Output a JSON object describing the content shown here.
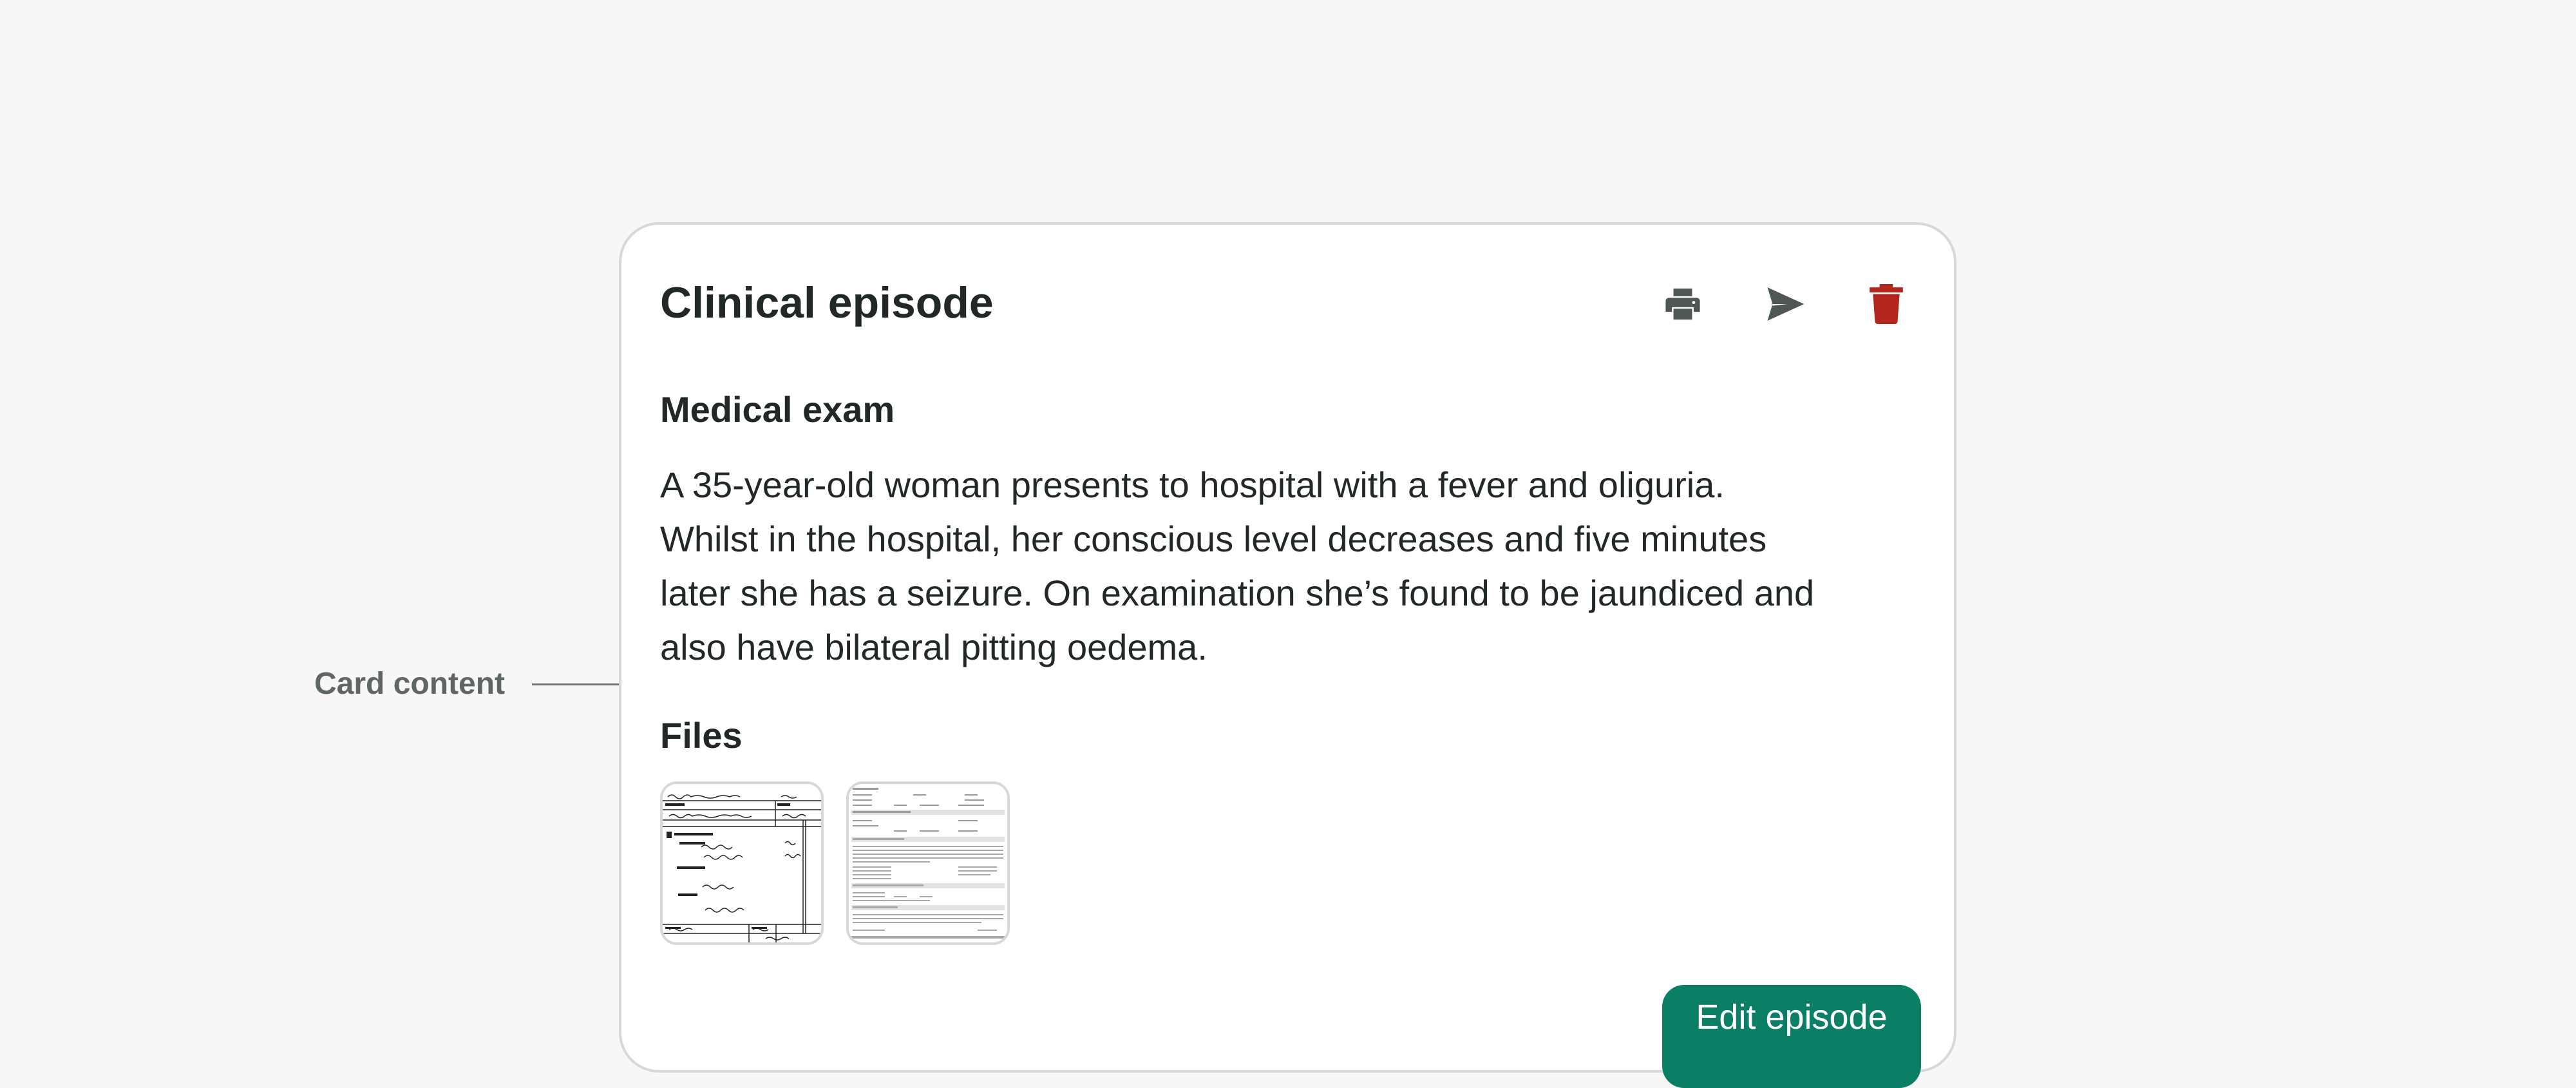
{
  "annotation": {
    "label": "Card content"
  },
  "card": {
    "title": "Clinical episode",
    "actions": {
      "print": {
        "icon": "printer-icon"
      },
      "send": {
        "icon": "send-icon"
      },
      "delete": {
        "icon": "trash-icon",
        "color": "#b3261e"
      }
    },
    "medical_exam": {
      "heading": "Medical exam",
      "lines": [
        "A 35-year-old woman presents to hospital with a fever and oliguria.",
        "Whilst in the hospital, her conscious level decreases and five minutes",
        "later she has a seizure. On examination she’s found to be jaundiced and",
        "also have bilateral pitting oedema."
      ]
    },
    "files": {
      "heading": "Files",
      "items": [
        {
          "type": "handwritten-form-thumbnail"
        },
        {
          "type": "printed-form-thumbnail"
        }
      ]
    },
    "edit_button": "Edit episode"
  },
  "colors": {
    "accent": "#0b7f66",
    "danger": "#b3261e",
    "icon": "#4f5755",
    "background": "#f6f7f6"
  }
}
